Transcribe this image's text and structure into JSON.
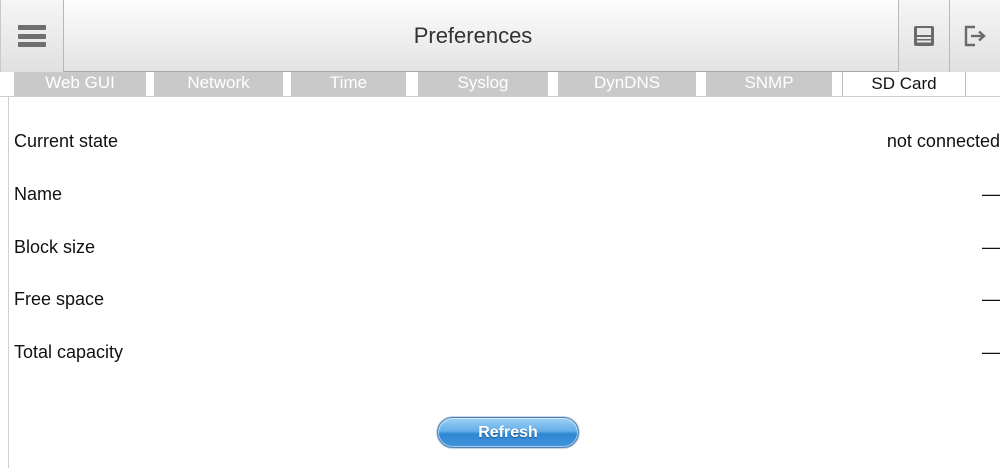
{
  "header": {
    "title": "Preferences",
    "menu_icon": "hamburger-menu-icon",
    "save_icon": "floppy-save-icon",
    "logout_icon": "logout-icon"
  },
  "tabs": [
    {
      "label": "Web GUI",
      "active": false
    },
    {
      "label": "Network",
      "active": false
    },
    {
      "label": "Time",
      "active": false
    },
    {
      "label": "Syslog",
      "active": false
    },
    {
      "label": "DynDNS",
      "active": false
    },
    {
      "label": "SNMP",
      "active": false
    },
    {
      "label": "SD Card",
      "active": true
    }
  ],
  "sd_card": {
    "rows": [
      {
        "label": "Current state",
        "value": "not connected"
      },
      {
        "label": "Name",
        "value": "—"
      },
      {
        "label": "Block size",
        "value": "—"
      },
      {
        "label": "Free space",
        "value": "—"
      },
      {
        "label": "Total capacity",
        "value": "—"
      }
    ],
    "refresh_label": "Refresh"
  },
  "colors": {
    "tab_inactive_bg": "#c9c9c9",
    "tab_inactive_text": "#ffffff",
    "button_blue": "#3f93da"
  }
}
